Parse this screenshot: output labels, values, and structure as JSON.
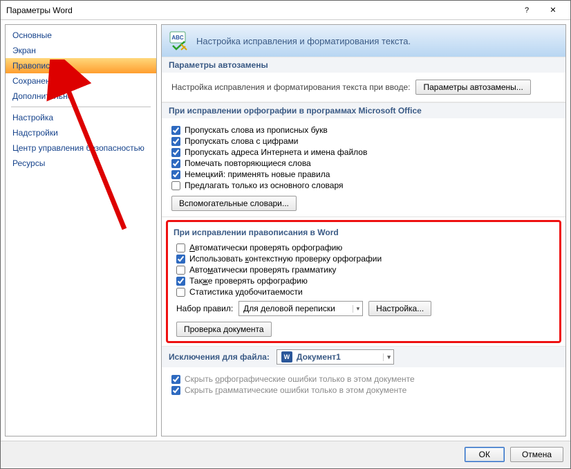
{
  "titlebar": {
    "title": "Параметры Word"
  },
  "sidebar": {
    "items": [
      {
        "label": "Основные",
        "selected": false
      },
      {
        "label": "Экран",
        "selected": false
      },
      {
        "label": "Правописание",
        "selected": true
      },
      {
        "label": "Сохранение",
        "selected": false
      },
      {
        "label": "Дополнительно",
        "selected": false
      }
    ],
    "items2": [
      {
        "label": "Настройка"
      },
      {
        "label": "Надстройки"
      },
      {
        "label": "Центр управления безопасностью"
      },
      {
        "label": "Ресурсы"
      }
    ]
  },
  "banner": {
    "text": "Настройка исправления и форматирования текста."
  },
  "autocorrect": {
    "title": "Параметры автозамены",
    "note": "Настройка исправления и форматирования текста при вводе:",
    "button": "Параметры автозамены..."
  },
  "office_spell": {
    "title": "При исправлении орфографии в программах Microsoft Office",
    "items": [
      {
        "label": "Пропускать слова из прописных букв",
        "checked": true
      },
      {
        "label": "Пропускать слова с цифрами",
        "checked": true
      },
      {
        "label": "Пропускать адреса Интернета и имена файлов",
        "checked": true
      },
      {
        "label": "Помечать повторяющиеся слова",
        "checked": true
      },
      {
        "label": "Немецкий: применять новые правила",
        "checked": true
      },
      {
        "label": "Предлагать только из основного словаря",
        "checked": false
      }
    ],
    "dict_button": "Вспомогательные словари..."
  },
  "word_spell": {
    "title": "При исправлении правописания в Word",
    "items": [
      {
        "label": "Автоматически проверять орфографию",
        "checked": false,
        "letter": ""
      },
      {
        "label": "Использовать контекстную проверку орфографии",
        "checked": true
      },
      {
        "label": "Автоматически проверять грамматику",
        "checked": false
      },
      {
        "label": "Также проверять орфографию",
        "checked": true
      },
      {
        "label": "Статистика удобочитаемости",
        "checked": false
      }
    ],
    "rules_label": "Набор правил:",
    "rules_value": "Для деловой переписки",
    "settings_button": "Настройка...",
    "check_doc_button": "Проверка документа"
  },
  "exceptions": {
    "title_label": "Исключения для файла:",
    "doc_name": "Документ1",
    "items": [
      {
        "label": "Скрыть орфографические ошибки только в этом документе",
        "checked": true
      },
      {
        "label": "Скрыть грамматические ошибки только в этом документе",
        "checked": true
      }
    ]
  },
  "footer": {
    "ok": "ОК",
    "cancel": "Отмена"
  }
}
